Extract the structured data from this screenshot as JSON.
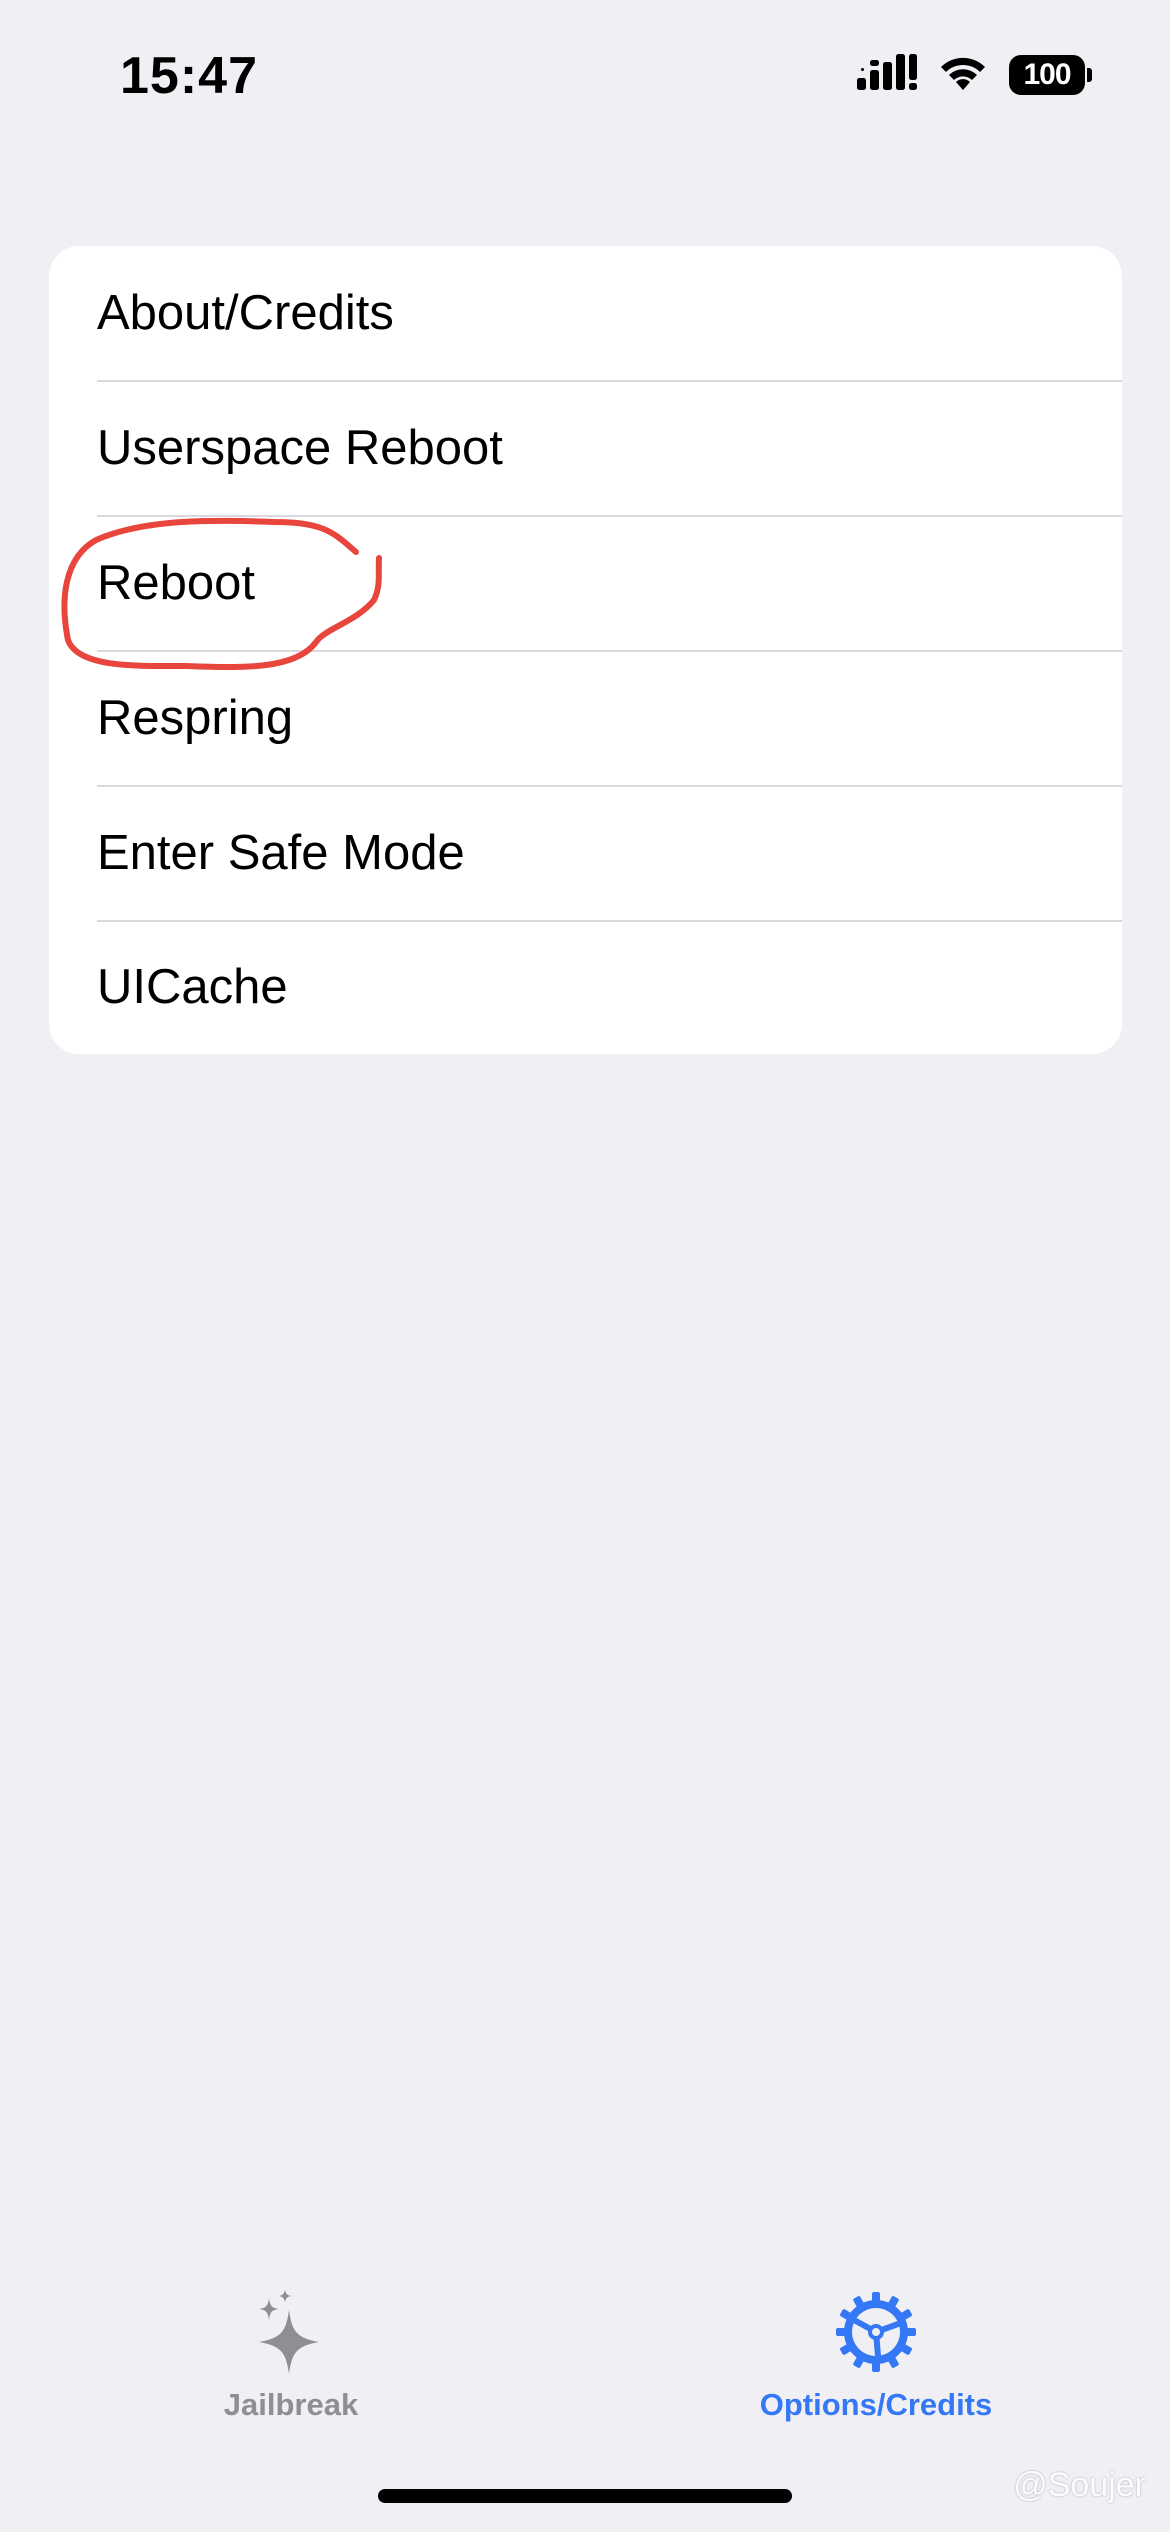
{
  "status_bar": {
    "time": "15:47",
    "battery_level": "100",
    "icons": [
      "cellular-signal-icon",
      "wifi-icon",
      "battery-icon"
    ]
  },
  "menu": {
    "items": [
      {
        "label": "About/Credits"
      },
      {
        "label": "Userspace Reboot"
      },
      {
        "label": "Reboot"
      },
      {
        "label": "Respring"
      },
      {
        "label": "Enter Safe Mode"
      },
      {
        "label": "UICache"
      }
    ]
  },
  "annotation": {
    "target": "Reboot",
    "color": "#e8453c"
  },
  "tab_bar": {
    "tabs": [
      {
        "label": "Jailbreak",
        "icon": "sparkles-icon",
        "selected": false
      },
      {
        "label": "Options/Credits",
        "icon": "gear-icon",
        "selected": true
      }
    ],
    "active_color": "#3478f6",
    "inactive_color": "#8e8e93"
  },
  "watermark": {
    "text": "@Soujer"
  }
}
